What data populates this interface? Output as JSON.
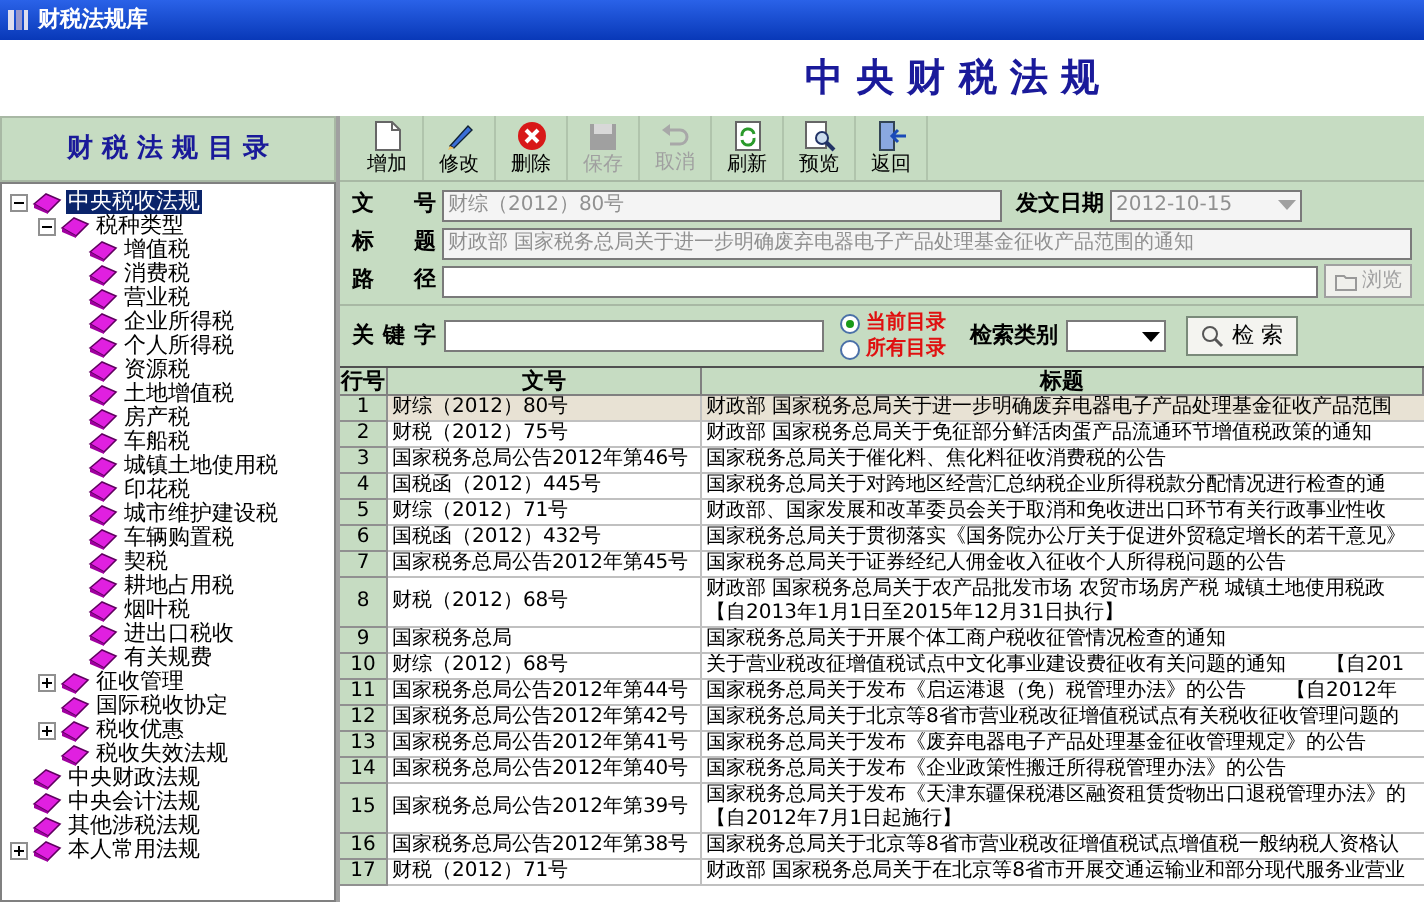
{
  "window": {
    "title": "财税法规库"
  },
  "banner": {
    "title": "中 央 财 税 法 规"
  },
  "sidebar": {
    "title": "财 税 法 规 目 录",
    "tree": [
      {
        "label": "中央税收法规",
        "selected": true,
        "expanded": true,
        "children": [
          {
            "label": "税种类型",
            "selected": false,
            "expanded": true,
            "children": [
              {
                "label": "增值税",
                "selected": false
              },
              {
                "label": "消费税",
                "selected": false
              },
              {
                "label": "营业税",
                "selected": false
              },
              {
                "label": "企业所得税",
                "selected": false
              },
              {
                "label": "个人所得税",
                "selected": false
              },
              {
                "label": "资源税",
                "selected": false
              },
              {
                "label": "土地增值税",
                "selected": false
              },
              {
                "label": "房产税",
                "selected": false
              },
              {
                "label": "车船税",
                "selected": false
              },
              {
                "label": "城镇土地使用税",
                "selected": false
              },
              {
                "label": "印花税",
                "selected": false
              },
              {
                "label": "城市维护建设税",
                "selected": false
              },
              {
                "label": "车辆购置税",
                "selected": false
              },
              {
                "label": "契税",
                "selected": false
              },
              {
                "label": "耕地占用税",
                "selected": false
              },
              {
                "label": "烟叶税",
                "selected": false
              },
              {
                "label": "进出口税收",
                "selected": false
              },
              {
                "label": "有关规费",
                "selected": false
              }
            ]
          },
          {
            "label": "征收管理",
            "selected": false,
            "expanded": false
          },
          {
            "label": "国际税收协定",
            "selected": false
          },
          {
            "label": "税收优惠",
            "selected": false,
            "expanded": false
          },
          {
            "label": "税收失效法规",
            "selected": false
          }
        ]
      },
      {
        "label": "中央财政法规",
        "selected": false
      },
      {
        "label": "中央会计法规",
        "selected": false
      },
      {
        "label": "其他涉税法规",
        "selected": false
      },
      {
        "label": "本人常用法规",
        "selected": false,
        "expanded": false
      }
    ]
  },
  "toolbar": [
    {
      "kind": "add",
      "label": "增加",
      "disabled": false
    },
    {
      "kind": "edit",
      "label": "修改",
      "disabled": false
    },
    {
      "kind": "delete",
      "label": "删除",
      "disabled": false
    },
    {
      "kind": "save",
      "label": "保存",
      "disabled": true
    },
    {
      "kind": "cancel",
      "label": "取消",
      "disabled": true
    },
    {
      "kind": "refresh",
      "label": "刷新",
      "disabled": false
    },
    {
      "kind": "preview",
      "label": "预览",
      "disabled": false
    },
    {
      "kind": "back",
      "label": "返回",
      "disabled": false
    }
  ],
  "form": {
    "doc_no": {
      "label": "文号",
      "value": "财综（2012）80号"
    },
    "date": {
      "label": "发文日期",
      "value": "2012-10-15"
    },
    "title": {
      "label": "标题",
      "value": "财政部 国家税务总局关于进一步明确废弃电器电子产品处理基金征收产品范围的通知"
    },
    "path": {
      "label": "路径"
    },
    "browse_button": {
      "label": "浏览",
      "disabled": true
    }
  },
  "search": {
    "keyword_label": "关键字",
    "scopes": [
      {
        "label": "当前目录",
        "selected": true
      },
      {
        "label": "所有目录",
        "selected": false
      }
    ],
    "category_label": "检索类别",
    "button": "检 索"
  },
  "table": {
    "columns": [
      "行号",
      "文号",
      "标题"
    ],
    "rows": [
      {
        "no": "1",
        "doc_no": "财综（2012）80号",
        "title": [
          "财政部 国家税务总局关于进一步明确废弃电器电子产品处理基金征收产品范围"
        ],
        "selected": true
      },
      {
        "no": "2",
        "doc_no": "财税（2012）75号",
        "title": [
          "财政部 国家税务总局关于免征部分鲜活肉蛋产品流通环节增值税政策的通知"
        ],
        "selected": false
      },
      {
        "no": "3",
        "doc_no": "国家税务总局公告2012年第46号",
        "title": [
          "国家税务总局关于催化料、焦化料征收消费税的公告"
        ],
        "selected": false
      },
      {
        "no": "4",
        "doc_no": "国税函（2012）445号",
        "title": [
          "国家税务总局关于对跨地区经营汇总纳税企业所得税款分配情况进行检查的通"
        ],
        "selected": false
      },
      {
        "no": "5",
        "doc_no": "财综（2012）71号",
        "title": [
          "财政部、国家发展和改革委员会关于取消和免收进出口环节有关行政事业性收"
        ],
        "selected": false
      },
      {
        "no": "6",
        "doc_no": "国税函（2012）432号",
        "title": [
          "国家税务总局关于贯彻落实《国务院办公厅关于促进外贸稳定增长的若干意见》"
        ],
        "selected": false
      },
      {
        "no": "7",
        "doc_no": "国家税务总局公告2012年第45号",
        "title": [
          "国家税务总局关于证券经纪人佣金收入征收个人所得税问题的公告"
        ],
        "selected": false
      },
      {
        "no": "8",
        "doc_no": "财税（2012）68号",
        "title": [
          "财政部 国家税务总局关于农产品批发市场 农贸市场房产税 城镇土地使用税政",
          "【自2013年1月1日至2015年12月31日执行】"
        ],
        "selected": false
      },
      {
        "no": "9",
        "doc_no": "国家税务总局",
        "title": [
          "国家税务总局关于开展个体工商户税收征管情况检查的通知"
        ],
        "selected": false
      },
      {
        "no": "10",
        "doc_no": "财综（2012）68号",
        "title": [
          "关于营业税改征增值税试点中文化事业建设费征收有关问题的通知　　【自201"
        ],
        "selected": false
      },
      {
        "no": "11",
        "doc_no": "国家税务总局公告2012年第44号",
        "title": [
          "国家税务总局关于发布《启运港退（免）税管理办法》的公告　　【自2012年"
        ],
        "selected": false
      },
      {
        "no": "12",
        "doc_no": "国家税务总局公告2012年第42号",
        "title": [
          "国家税务总局关于北京等8省市营业税改征增值税试点有关税收征收管理问题的"
        ],
        "selected": false
      },
      {
        "no": "13",
        "doc_no": "国家税务总局公告2012年第41号",
        "title": [
          "国家税务总局关于发布《废弃电器电子产品处理基金征收管理规定》的公告"
        ],
        "selected": false
      },
      {
        "no": "14",
        "doc_no": "国家税务总局公告2012年第40号",
        "title": [
          "国家税务总局关于发布《企业政策性搬迁所得税管理办法》的公告"
        ],
        "selected": false
      },
      {
        "no": "15",
        "doc_no": "国家税务总局公告2012年第39号",
        "title": [
          "国家税务总局关于发布《天津东疆保税港区融资租赁货物出口退税管理办法》的",
          "【自2012年7月1日起施行】"
        ],
        "selected": false
      },
      {
        "no": "16",
        "doc_no": "国家税务总局公告2012年第38号",
        "title": [
          "国家税务总局关于北京等8省市营业税改征增值税试点增值税一般纳税人资格认"
        ],
        "selected": false
      },
      {
        "no": "17",
        "doc_no": "财税（2012）71号",
        "title": [
          "财政部 国家税务总局关于在北京等8省市开展交通运输业和部分现代服务业营业"
        ],
        "selected": false
      }
    ]
  }
}
